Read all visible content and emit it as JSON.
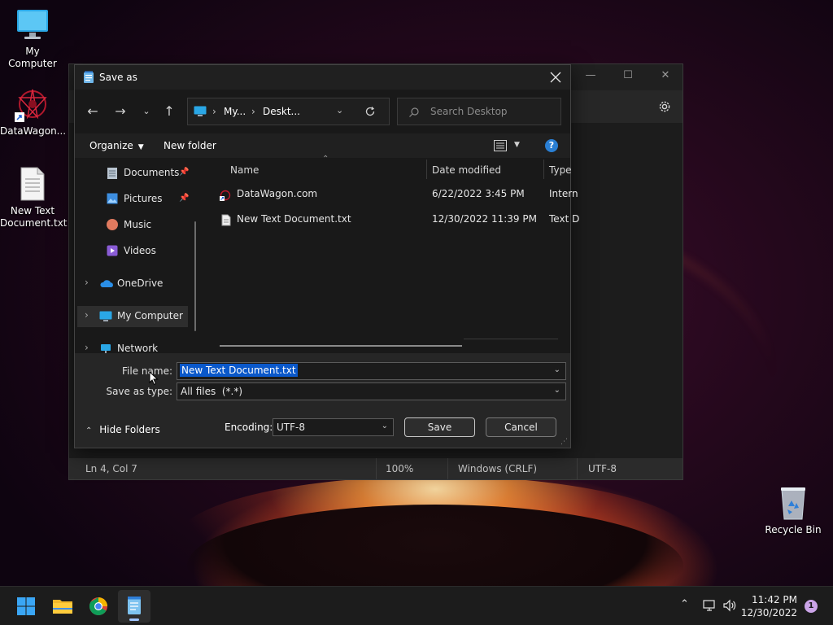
{
  "desktop": {
    "icons": [
      {
        "label": "My Computer",
        "icon": "monitor-icon"
      },
      {
        "label": "DataWagon...",
        "icon": "datawagon-icon"
      },
      {
        "label": "New Text Document.txt",
        "icon": "text-file-icon"
      },
      {
        "label": "Recycle Bin",
        "icon": "recycle-bin-icon"
      }
    ]
  },
  "notepad": {
    "status": {
      "position": "Ln 4, Col 7",
      "zoom": "100%",
      "line_endings": "Windows (CRLF)",
      "encoding": "UTF-8"
    }
  },
  "dialog": {
    "title": "Save as",
    "address": {
      "segments": [
        "My...",
        "Deskt..."
      ]
    },
    "search_placeholder": "Search Desktop",
    "toolbar": {
      "organize": "Organize",
      "new_folder": "New folder"
    },
    "nav_items": [
      {
        "label": "Documents",
        "icon": "documents-icon",
        "pinned": true
      },
      {
        "label": "Pictures",
        "icon": "pictures-icon",
        "pinned": true
      },
      {
        "label": "Music",
        "icon": "music-icon"
      },
      {
        "label": "Videos",
        "icon": "videos-icon"
      },
      {
        "label": "OneDrive",
        "icon": "onedrive-icon",
        "expandable": true
      },
      {
        "label": "My Computer",
        "icon": "computer-icon",
        "expandable": true,
        "selected": true
      },
      {
        "label": "Network",
        "icon": "network-icon",
        "expandable": true
      }
    ],
    "columns": [
      "Name",
      "Date modified",
      "Type"
    ],
    "files": [
      {
        "name": "DataWagon.com",
        "date": "6/22/2022 3:45 PM",
        "type": "Intern",
        "icon": "shortcut-icon"
      },
      {
        "name": "New Text Document.txt",
        "date": "12/30/2022 11:39 PM",
        "type": "Text D",
        "icon": "text-file-icon"
      }
    ],
    "file_name_label": "File name:",
    "file_name_value": "New Text Document.txt",
    "save_type_label": "Save as type:",
    "save_type_value": "All files  (*.*)",
    "hide_folders": "Hide Folders",
    "encoding_label": "Encoding:",
    "encoding_value": "UTF-8",
    "save": "Save",
    "cancel": "Cancel"
  },
  "taskbar": {
    "time": "11:42 PM",
    "date": "12/30/2022",
    "notifications": "1"
  }
}
